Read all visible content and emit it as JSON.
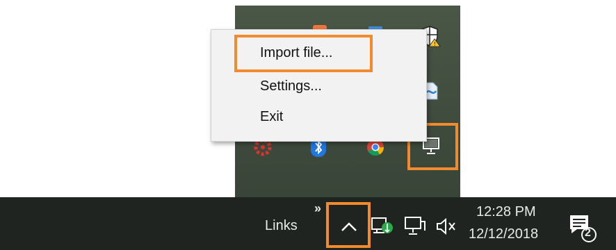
{
  "context_menu": {
    "items": [
      {
        "label": "Import file..."
      },
      {
        "label": "Settings..."
      },
      {
        "label": "Exit"
      }
    ]
  },
  "taskbar": {
    "toolbar_label": "Links",
    "toolbar_more": "»",
    "clock_time": "12:28 PM",
    "clock_date": "12/12/2018",
    "notification_count": "2"
  },
  "tray_icons": [
    "app-icon",
    "app-icon",
    "app-icon",
    "security-warning-icon",
    "file-icon",
    "network-computer-icon",
    "crown-icon",
    "bluetooth-icon",
    "chrome-icon"
  ],
  "colors": {
    "highlight": "#f28a2e",
    "taskbar": "#1f2421",
    "menu_background": "#f2f2f2",
    "flyout_background": "#3f4b3d"
  }
}
